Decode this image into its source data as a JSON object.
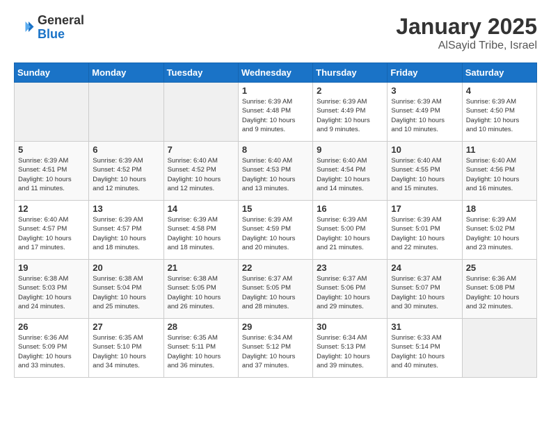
{
  "header": {
    "logo_general": "General",
    "logo_blue": "Blue",
    "month_title": "January 2025",
    "subtitle": "AlSayid Tribe, Israel"
  },
  "weekdays": [
    "Sunday",
    "Monday",
    "Tuesday",
    "Wednesday",
    "Thursday",
    "Friday",
    "Saturday"
  ],
  "weeks": [
    [
      {
        "day": "",
        "info": ""
      },
      {
        "day": "",
        "info": ""
      },
      {
        "day": "",
        "info": ""
      },
      {
        "day": "1",
        "info": "Sunrise: 6:39 AM\nSunset: 4:48 PM\nDaylight: 10 hours\nand 9 minutes."
      },
      {
        "day": "2",
        "info": "Sunrise: 6:39 AM\nSunset: 4:49 PM\nDaylight: 10 hours\nand 9 minutes."
      },
      {
        "day": "3",
        "info": "Sunrise: 6:39 AM\nSunset: 4:49 PM\nDaylight: 10 hours\nand 10 minutes."
      },
      {
        "day": "4",
        "info": "Sunrise: 6:39 AM\nSunset: 4:50 PM\nDaylight: 10 hours\nand 10 minutes."
      }
    ],
    [
      {
        "day": "5",
        "info": "Sunrise: 6:39 AM\nSunset: 4:51 PM\nDaylight: 10 hours\nand 11 minutes."
      },
      {
        "day": "6",
        "info": "Sunrise: 6:39 AM\nSunset: 4:52 PM\nDaylight: 10 hours\nand 12 minutes."
      },
      {
        "day": "7",
        "info": "Sunrise: 6:40 AM\nSunset: 4:52 PM\nDaylight: 10 hours\nand 12 minutes."
      },
      {
        "day": "8",
        "info": "Sunrise: 6:40 AM\nSunset: 4:53 PM\nDaylight: 10 hours\nand 13 minutes."
      },
      {
        "day": "9",
        "info": "Sunrise: 6:40 AM\nSunset: 4:54 PM\nDaylight: 10 hours\nand 14 minutes."
      },
      {
        "day": "10",
        "info": "Sunrise: 6:40 AM\nSunset: 4:55 PM\nDaylight: 10 hours\nand 15 minutes."
      },
      {
        "day": "11",
        "info": "Sunrise: 6:40 AM\nSunset: 4:56 PM\nDaylight: 10 hours\nand 16 minutes."
      }
    ],
    [
      {
        "day": "12",
        "info": "Sunrise: 6:40 AM\nSunset: 4:57 PM\nDaylight: 10 hours\nand 17 minutes."
      },
      {
        "day": "13",
        "info": "Sunrise: 6:39 AM\nSunset: 4:57 PM\nDaylight: 10 hours\nand 18 minutes."
      },
      {
        "day": "14",
        "info": "Sunrise: 6:39 AM\nSunset: 4:58 PM\nDaylight: 10 hours\nand 18 minutes."
      },
      {
        "day": "15",
        "info": "Sunrise: 6:39 AM\nSunset: 4:59 PM\nDaylight: 10 hours\nand 20 minutes."
      },
      {
        "day": "16",
        "info": "Sunrise: 6:39 AM\nSunset: 5:00 PM\nDaylight: 10 hours\nand 21 minutes."
      },
      {
        "day": "17",
        "info": "Sunrise: 6:39 AM\nSunset: 5:01 PM\nDaylight: 10 hours\nand 22 minutes."
      },
      {
        "day": "18",
        "info": "Sunrise: 6:39 AM\nSunset: 5:02 PM\nDaylight: 10 hours\nand 23 minutes."
      }
    ],
    [
      {
        "day": "19",
        "info": "Sunrise: 6:38 AM\nSunset: 5:03 PM\nDaylight: 10 hours\nand 24 minutes."
      },
      {
        "day": "20",
        "info": "Sunrise: 6:38 AM\nSunset: 5:04 PM\nDaylight: 10 hours\nand 25 minutes."
      },
      {
        "day": "21",
        "info": "Sunrise: 6:38 AM\nSunset: 5:05 PM\nDaylight: 10 hours\nand 26 minutes."
      },
      {
        "day": "22",
        "info": "Sunrise: 6:37 AM\nSunset: 5:05 PM\nDaylight: 10 hours\nand 28 minutes."
      },
      {
        "day": "23",
        "info": "Sunrise: 6:37 AM\nSunset: 5:06 PM\nDaylight: 10 hours\nand 29 minutes."
      },
      {
        "day": "24",
        "info": "Sunrise: 6:37 AM\nSunset: 5:07 PM\nDaylight: 10 hours\nand 30 minutes."
      },
      {
        "day": "25",
        "info": "Sunrise: 6:36 AM\nSunset: 5:08 PM\nDaylight: 10 hours\nand 32 minutes."
      }
    ],
    [
      {
        "day": "26",
        "info": "Sunrise: 6:36 AM\nSunset: 5:09 PM\nDaylight: 10 hours\nand 33 minutes."
      },
      {
        "day": "27",
        "info": "Sunrise: 6:35 AM\nSunset: 5:10 PM\nDaylight: 10 hours\nand 34 minutes."
      },
      {
        "day": "28",
        "info": "Sunrise: 6:35 AM\nSunset: 5:11 PM\nDaylight: 10 hours\nand 36 minutes."
      },
      {
        "day": "29",
        "info": "Sunrise: 6:34 AM\nSunset: 5:12 PM\nDaylight: 10 hours\nand 37 minutes."
      },
      {
        "day": "30",
        "info": "Sunrise: 6:34 AM\nSunset: 5:13 PM\nDaylight: 10 hours\nand 39 minutes."
      },
      {
        "day": "31",
        "info": "Sunrise: 6:33 AM\nSunset: 5:14 PM\nDaylight: 10 hours\nand 40 minutes."
      },
      {
        "day": "",
        "info": ""
      }
    ]
  ]
}
